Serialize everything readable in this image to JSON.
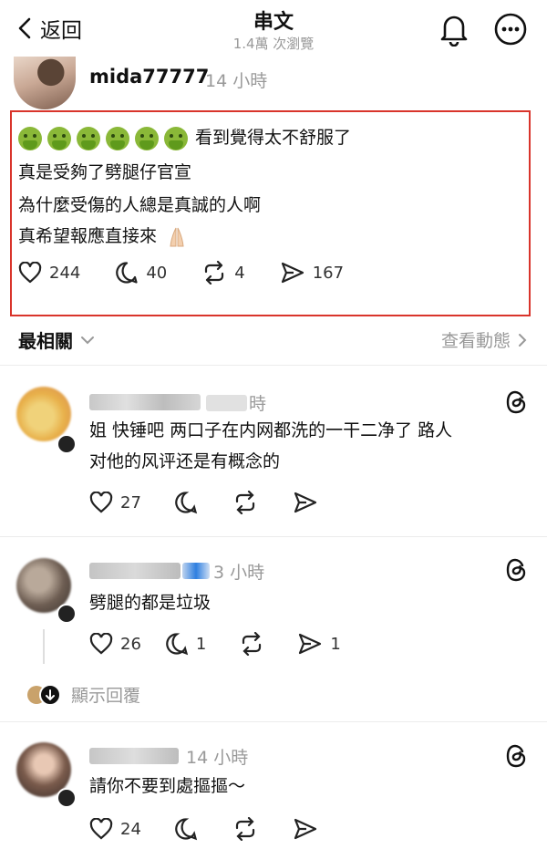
{
  "header": {
    "back_label": "返回",
    "title": "串文",
    "views": "1.4萬 次瀏覽"
  },
  "post": {
    "username": "mida77777",
    "time": "14 小時",
    "lines": [
      "看到覺得太不舒服了",
      "真是受夠了劈腿仔官宣",
      "為什麼受傷的人總是真誠的人啊",
      "真希望報應直接來"
    ],
    "likes": "244",
    "comments": "40",
    "reposts": "4",
    "shares": "167"
  },
  "sort": {
    "label": "最相關",
    "activity_label": "查看動態"
  },
  "replies": [
    {
      "time": "時",
      "text_lines": [
        "姐 快锤吧 两口子在内网都洗的一干二净了 路人",
        "对他的风评还是有概念的"
      ],
      "likes": "27"
    },
    {
      "time": "3 小時",
      "text_lines": [
        "劈腿的都是垃圾"
      ],
      "likes": "26",
      "comments": "1",
      "shares": "1"
    },
    {
      "time": "14 小時",
      "text_lines": [
        "請你不要到處摳摳～"
      ],
      "likes": "24"
    }
  ],
  "show_replies_label": "顯示回覆",
  "colors": {
    "highlight_border": "#d9342b",
    "muted_text": "#999999"
  }
}
